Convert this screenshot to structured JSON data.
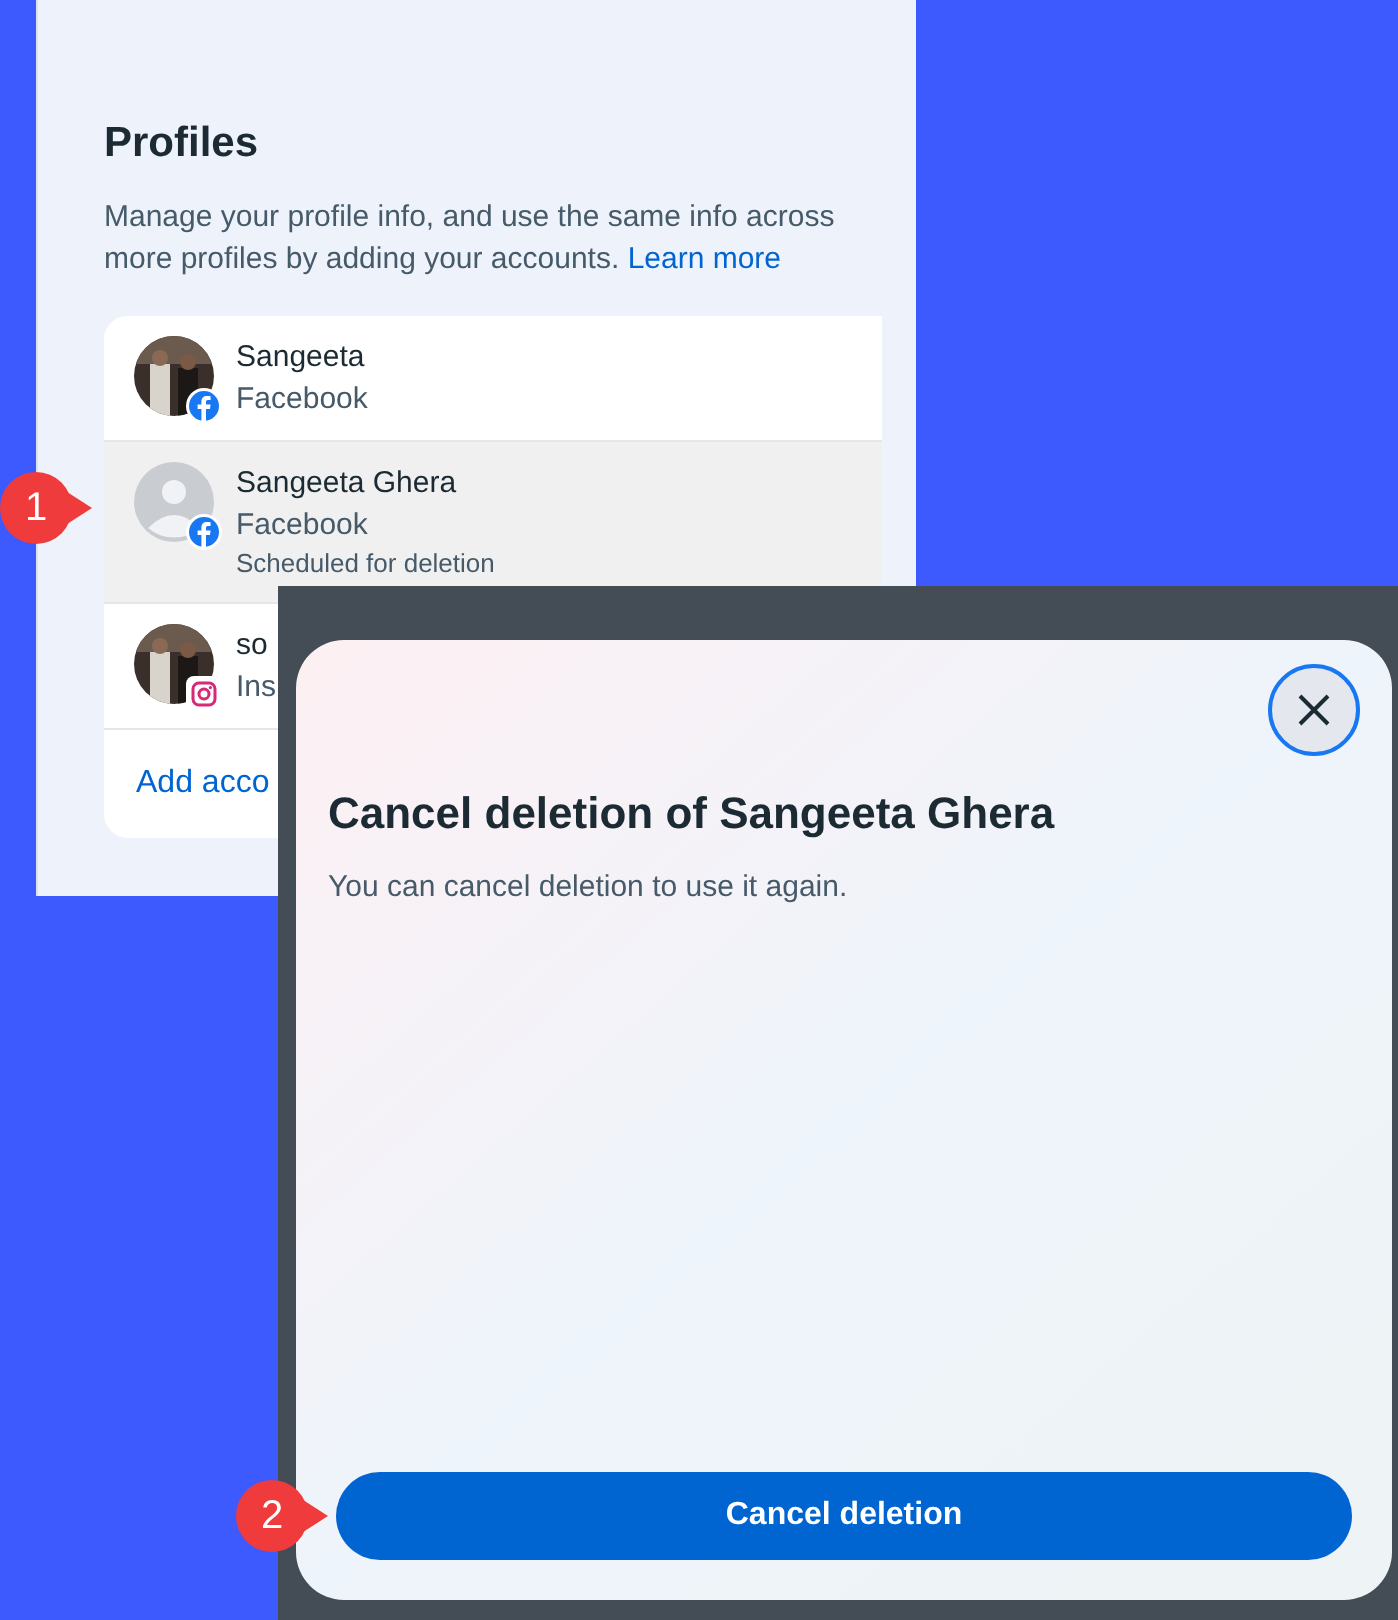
{
  "profiles_section": {
    "title": "Profiles",
    "description": "Manage your profile info, and use the same info across more profiles by adding your accounts.",
    "learn_more": "Learn more",
    "items": [
      {
        "name": "Sangeeta",
        "platform": "Facebook",
        "network": {
          "kind": "facebook"
        },
        "selected": false
      },
      {
        "name": "Sangeeta Ghera",
        "platform": "Facebook",
        "status": "Scheduled for deletion",
        "avatar": {
          "kind": "placeholder"
        },
        "network": {
          "kind": "facebook"
        },
        "selected": true
      },
      {
        "name": "so",
        "platform": "Ins",
        "network": {
          "kind": "instagram"
        },
        "selected": false
      }
    ],
    "add_account": "Add acco"
  },
  "dialog": {
    "title": "Cancel deletion of Sangeeta Ghera",
    "subtitle": "You can cancel deletion to use it again.",
    "button": "Cancel deletion"
  },
  "callouts": [
    "1",
    "2"
  ]
}
